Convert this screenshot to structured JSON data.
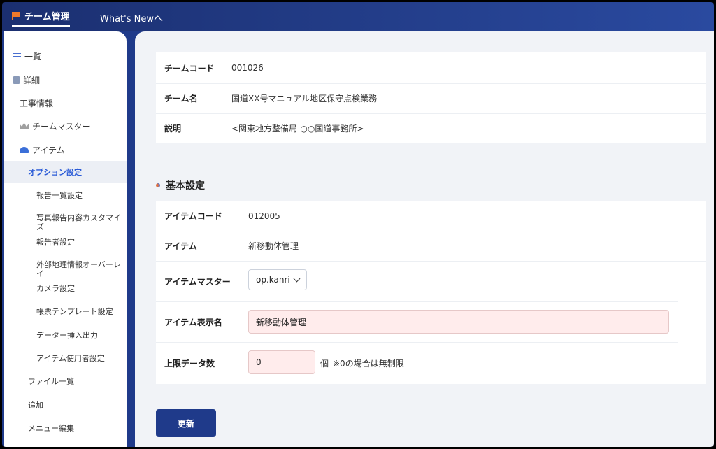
{
  "header": {
    "brand": "チーム管理",
    "whats_new": "What's Newへ"
  },
  "sidebar": {
    "items": [
      {
        "label": "一覧",
        "icon": "list-icon"
      },
      {
        "label": "詳細",
        "icon": "document-icon"
      },
      {
        "label": "工事情報"
      },
      {
        "label": "チームマスター",
        "icon": "crown-icon"
      },
      {
        "label": "アイテム",
        "icon": "helmet-icon"
      },
      {
        "label": "オプション設定",
        "active": true
      },
      {
        "label": "報告一覧設定"
      },
      {
        "label": "写真報告内容カスタマイズ"
      },
      {
        "label": "報告者設定"
      },
      {
        "label": "外部地理情報オーバーレイ"
      },
      {
        "label": "カメラ設定"
      },
      {
        "label": "帳票テンプレート設定"
      },
      {
        "label": "データー挿入出力"
      },
      {
        "label": "アイテム使用者設定"
      },
      {
        "label": "ファイル一覧"
      },
      {
        "label": "追加"
      },
      {
        "label": "メニュー編集"
      }
    ]
  },
  "team": {
    "code_label": "チームコード",
    "code_value": "001026",
    "name_label": "チーム名",
    "name_value": "国道XX号マニュアル地区保守点検業務",
    "desc_label": "説明",
    "desc_value": "<関東地方整備局-○○国道事務所>"
  },
  "basic": {
    "title": "基本設定",
    "item_code_label": "アイテムコード",
    "item_code_value": "012005",
    "item_label": "アイテム",
    "item_value": "新移動体管理",
    "item_master_label": "アイテムマスター",
    "item_master_value": "op.kanri",
    "display_name_label": "アイテム表示名",
    "display_name_value": "新移動体管理",
    "limit_label": "上限データ数",
    "limit_value": "0",
    "limit_unit": "個",
    "limit_note": "※0の場合は無制限"
  },
  "actions": {
    "update_label": "更新"
  },
  "colors": {
    "accent": "#1f3a8a",
    "active_nav": "#2a5bd7",
    "field_bg": "#ffecec"
  }
}
